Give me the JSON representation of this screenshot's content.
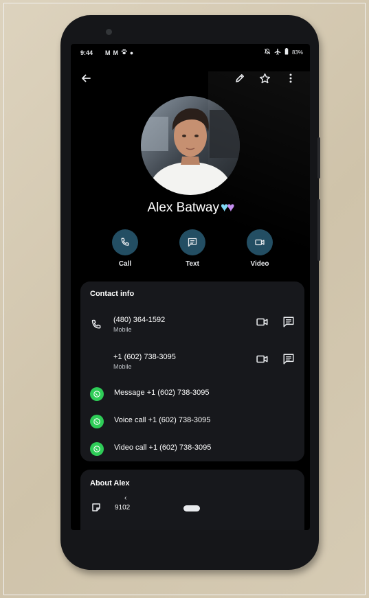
{
  "status_bar": {
    "time": "9:44",
    "left_icons": [
      "gmail-icon",
      "gmail-icon",
      "paw-icon",
      "dot-icon"
    ],
    "right_icons": [
      "mute-icon",
      "airplane-icon",
      "battery-icon"
    ],
    "battery": "83%"
  },
  "topbar": {
    "icons": [
      "back-arrow-icon",
      "edit-pencil-icon",
      "star-icon",
      "more-vert-icon"
    ]
  },
  "contact": {
    "name": "Alex Batway",
    "name_emoji": "💙💜"
  },
  "actions": [
    {
      "label": "Call",
      "icon": "phone-icon"
    },
    {
      "label": "Text",
      "icon": "message-icon"
    },
    {
      "label": "Video",
      "icon": "video-icon"
    }
  ],
  "contact_info": {
    "title": "Contact info",
    "phones": [
      {
        "number": "(480) 364-1592",
        "type": "Mobile"
      },
      {
        "number": "+1 (602) 738-3095",
        "type": "Mobile"
      }
    ],
    "whatsapp": [
      {
        "label": "Message +1 (602) 738-3095"
      },
      {
        "label": "Voice call +1 (602) 738-3095"
      },
      {
        "label": "Video call +1 (602) 738-3095"
      }
    ]
  },
  "about": {
    "title": "About Alex",
    "value": "9102",
    "icon": "note-icon"
  },
  "colors": {
    "screen_bg": "#000000",
    "card_bg": "#17181c",
    "action_circle": "#234e63",
    "whatsapp_green": "#2ecc57",
    "text_primary": "#ffffff",
    "text_secondary": "#bdc1c6"
  }
}
